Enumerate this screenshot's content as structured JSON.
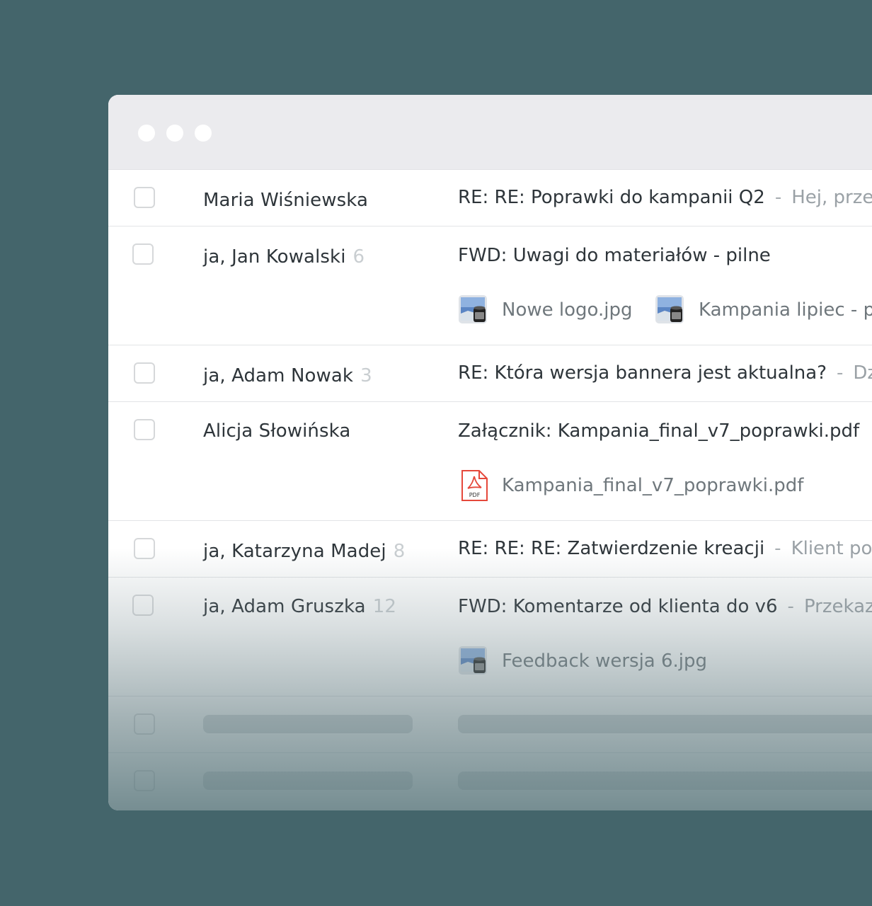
{
  "emails": [
    {
      "sender": "Maria Wiśniewska",
      "count": "",
      "subject": "RE: RE: Poprawki do kampanii Q2",
      "separator": "-",
      "snippet": "Hej, przes"
    },
    {
      "sender": "ja, Jan Kowalski",
      "count": "6",
      "subject": "FWD: Uwagi do materiałów - pilne",
      "attachments": [
        {
          "name": "Nowe logo.jpg",
          "icon": "image-icon"
        },
        {
          "name": "Kampania lipiec - p",
          "icon": "image-icon"
        }
      ]
    },
    {
      "sender": "ja, Adam Nowak",
      "count": "3",
      "subject": "RE: Która wersja bannera jest aktualna?",
      "separator": "-",
      "snippet": "Dzie"
    },
    {
      "sender": "Alicja Słowińska",
      "count": "",
      "subject": "Załącznik: Kampania_final_v7_poprawki.pdf",
      "attachments": [
        {
          "name": "Kampania_final_v7_poprawki.pdf",
          "icon": "pdf-icon",
          "icon_label": "PDF"
        }
      ]
    },
    {
      "sender": "ja, Katarzyna Madej",
      "count": "8",
      "subject": "RE: RE: RE: Zatwierdzenie kreacji",
      "separator": "-",
      "snippet": "Klient pop"
    },
    {
      "sender": "ja, Adam Gruszka",
      "count": "12",
      "subject": "FWD: Komentarze od klienta do v6",
      "separator": "-",
      "snippet": "Przekazu",
      "attachments": [
        {
          "name": "Feedback wersja 6.jpg",
          "icon": "image-icon"
        }
      ]
    }
  ],
  "colors": {
    "background": "#44656b",
    "window": "#ffffff",
    "titlebar": "#ebebee",
    "pdf_red": "#e5483b"
  }
}
